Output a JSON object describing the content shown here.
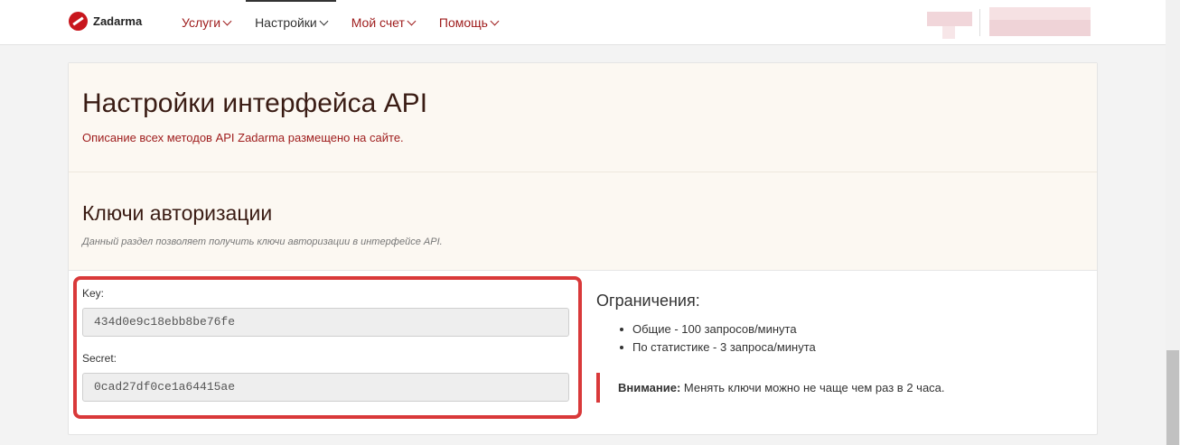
{
  "header": {
    "logo_text": "Zadarma",
    "nav": [
      {
        "label": "Услуги"
      },
      {
        "label": "Настройки"
      },
      {
        "label": "Мой счет"
      },
      {
        "label": "Помощь"
      }
    ]
  },
  "page": {
    "title": "Настройки интерфейса API",
    "description": "Описание всех методов API Zadarma размещено на сайте.",
    "auth_title": "Ключи авторизации",
    "auth_note": "Данный раздел позволяет получить ключи авторизации в интерфейсе API."
  },
  "keys": {
    "key_label": "Key:",
    "key_value": "434d0e9c18ebb8be76fe",
    "secret_label": "Secret:",
    "secret_value": "0cad27df0ce1a64415ae"
  },
  "limits": {
    "title": "Ограничения:",
    "items": [
      "Общие - 100 запросов/минута",
      "По статистике - 3 запроса/минута"
    ],
    "warning_label": "Внимание:",
    "warning_text": " Менять ключи можно не чаще чем раз в 2 часа."
  },
  "colors": {
    "brand": "#c8161d",
    "nav_link": "#9e1b1b",
    "highlight_frame": "#d9393a",
    "panel_bg": "#fcf8f2"
  }
}
